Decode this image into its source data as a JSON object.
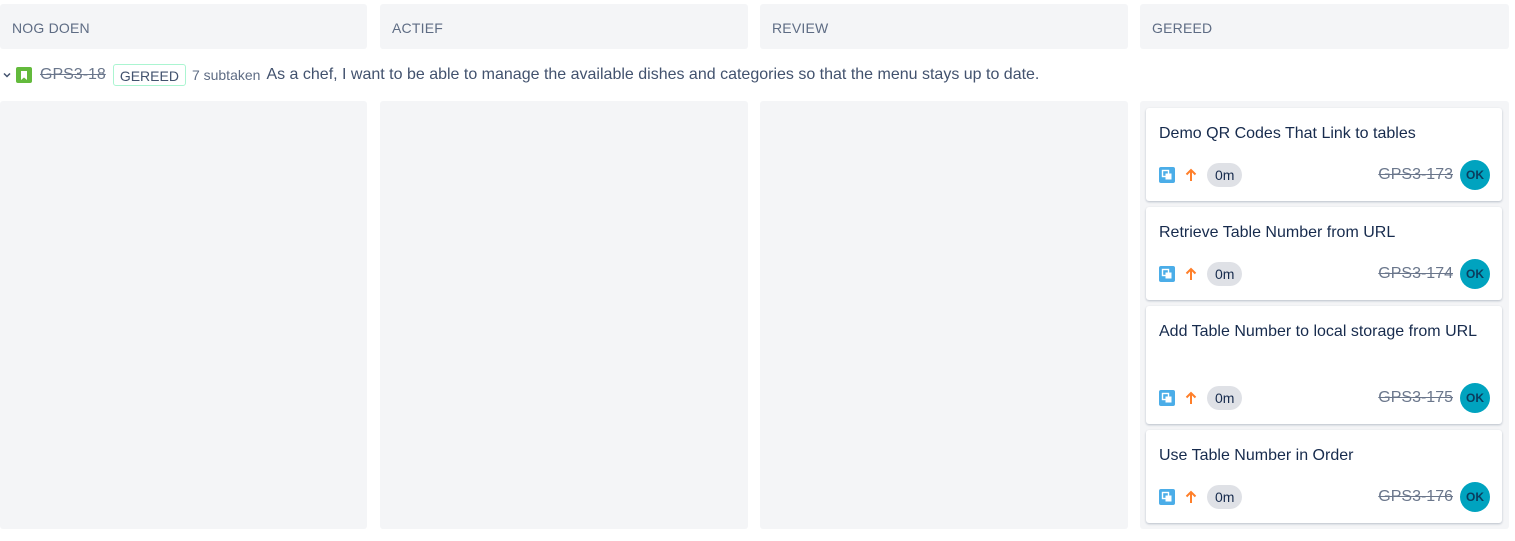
{
  "columns": [
    {
      "name": "NOG DOEN"
    },
    {
      "name": "ACTIEF"
    },
    {
      "name": "REVIEW"
    },
    {
      "name": "GEREED"
    }
  ],
  "swimlane": {
    "key": "GPS3-18",
    "status": "GEREED",
    "subtask_count": "7 subtaken",
    "summary": "As a chef, I want to be able to manage the available dishes and categories so that the menu stays up to date."
  },
  "cards": [
    {
      "title": "Demo QR Codes That Link to tables",
      "estimate": "0m",
      "key": "GPS3-173",
      "assignee": "OK"
    },
    {
      "title": "Retrieve Table Number from URL",
      "estimate": "0m",
      "key": "GPS3-174",
      "assignee": "OK"
    },
    {
      "title": "Add Table Number to local storage from URL",
      "estimate": "0m",
      "key": "GPS3-175",
      "assignee": "OK"
    },
    {
      "title": "Use Table Number in Order",
      "estimate": "0m",
      "key": "GPS3-176",
      "assignee": "OK"
    }
  ],
  "icons": {
    "swimlane_toggle": "chevron-down-icon",
    "story_type": "story-bookmark-icon",
    "card_type": "subtask-icon",
    "priority": "priority-high-arrow-up-icon"
  },
  "colors": {
    "story": "#63ba3c",
    "subtask": "#4bade8",
    "priority": "#ff7f2a",
    "avatar": "#00a3bf",
    "column_bg": "#f4f5f7",
    "done_border": "#abf5d1"
  }
}
